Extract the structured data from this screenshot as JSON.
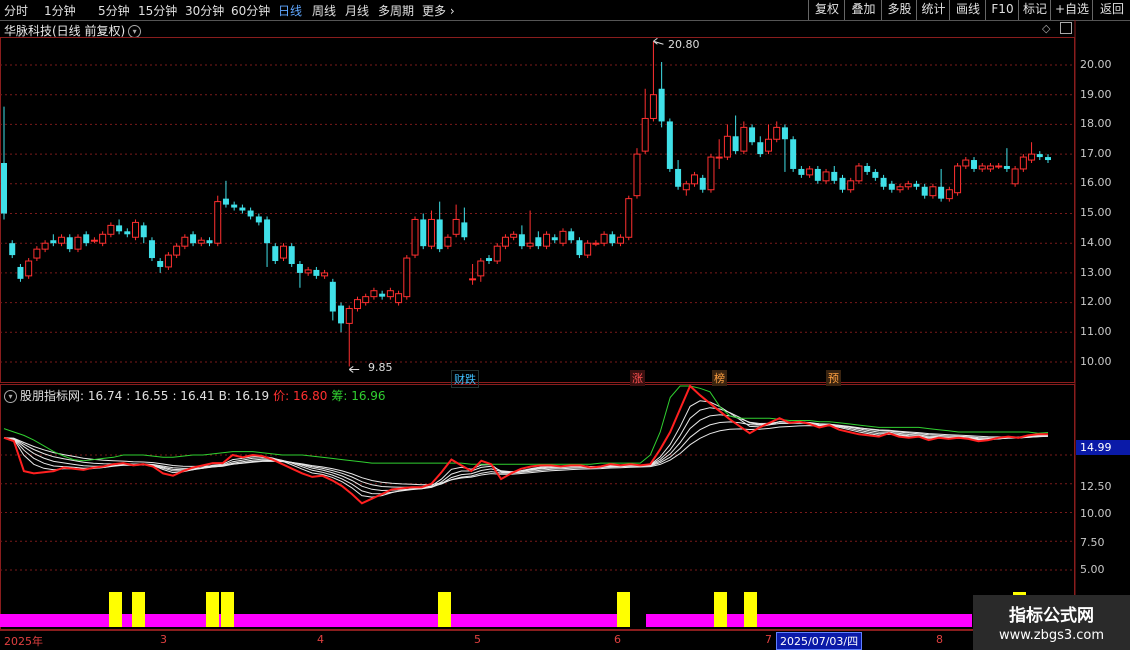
{
  "toolbar": {
    "periods": [
      "分时",
      "1分钟",
      "5分钟",
      "15分钟",
      "30分钟",
      "60分钟",
      "日线",
      "周线",
      "月线",
      "多周期"
    ],
    "active_period": "日线",
    "more_label": "更多",
    "right_buttons": [
      "复权",
      "叠加",
      "多股",
      "统计",
      "画线",
      "F10",
      "+自选",
      "返回"
    ]
  },
  "stock": {
    "title": "华脉科技(日线 前复权)"
  },
  "price_axis": [
    "20.00",
    "19.00",
    "18.00",
    "17.00",
    "16.00",
    "15.00",
    "14.00",
    "13.00",
    "12.00",
    "11.00",
    "10.00"
  ],
  "high_label": "20.80",
  "low_label": "9.85",
  "events": [
    {
      "label": "财跌",
      "color": "#40c0ff"
    },
    {
      "label": "涨",
      "color": "#ff5050"
    },
    {
      "label": "榜",
      "color": "#ffa040"
    },
    {
      "label": "预",
      "color": "#ffa040"
    }
  ],
  "indicator": {
    "name": "股朋指标网",
    "v1": ": 16.74",
    "v2": ": 16.55",
    "v3": ": 16.41",
    "b_label": "B: 16.19",
    "price_label": "价: 16.80",
    "chip_label": "筹: 16.96",
    "axis": [
      "12.50",
      "10.00",
      "7.50",
      "5.00"
    ],
    "axis_partial": "15.00",
    "current_value": "14.99",
    "colors": {
      "price": "#ff3030",
      "chip": "#30d030",
      "b": "#e0e0e0"
    }
  },
  "xaxis": {
    "labels": [
      "2025年",
      "3",
      "4",
      "5",
      "6",
      "7",
      "8"
    ],
    "cursor_date": "2025/07/03/四"
  },
  "watermark": {
    "line1": "指标公式网",
    "line2": "www.zbgs3.com"
  },
  "chart_data": {
    "type": "candlestick",
    "price_range": [
      9.85,
      20.8
    ],
    "candles": [
      [
        16.7,
        15.0,
        18.6,
        14.8
      ],
      [
        14.0,
        13.6,
        14.1,
        13.5
      ],
      [
        13.2,
        12.8,
        13.3,
        12.7
      ],
      [
        12.9,
        13.4,
        13.5,
        12.8
      ],
      [
        13.5,
        13.8,
        13.9,
        13.4
      ],
      [
        13.8,
        14.0,
        14.1,
        13.7
      ],
      [
        14.1,
        14.0,
        14.3,
        13.9
      ],
      [
        14.0,
        14.2,
        14.3,
        13.9
      ],
      [
        14.2,
        13.8,
        14.3,
        13.7
      ],
      [
        13.8,
        14.2,
        14.3,
        13.7
      ],
      [
        14.3,
        14.0,
        14.4,
        13.9
      ],
      [
        14.1,
        14.1,
        14.2,
        14.0
      ],
      [
        14.0,
        14.3,
        14.4,
        13.9
      ],
      [
        14.3,
        14.6,
        14.7,
        14.2
      ],
      [
        14.6,
        14.4,
        14.8,
        14.3
      ],
      [
        14.4,
        14.3,
        14.5,
        14.2
      ],
      [
        14.2,
        14.7,
        14.8,
        14.1
      ],
      [
        14.6,
        14.2,
        14.7,
        14.0
      ],
      [
        14.1,
        13.5,
        14.2,
        13.4
      ],
      [
        13.4,
        13.2,
        13.5,
        13.0
      ],
      [
        13.2,
        13.6,
        13.7,
        13.1
      ],
      [
        13.6,
        13.9,
        14.0,
        13.5
      ],
      [
        13.9,
        14.2,
        14.3,
        13.8
      ],
      [
        14.3,
        14.0,
        14.4,
        13.9
      ],
      [
        14.0,
        14.1,
        14.2,
        13.9
      ],
      [
        14.1,
        14.0,
        14.2,
        13.9
      ],
      [
        14.0,
        15.4,
        15.6,
        13.9
      ],
      [
        15.5,
        15.3,
        16.1,
        15.2
      ],
      [
        15.3,
        15.2,
        15.4,
        15.1
      ],
      [
        15.2,
        15.1,
        15.3,
        15.0
      ],
      [
        15.1,
        14.9,
        15.2,
        14.8
      ],
      [
        14.9,
        14.7,
        15.0,
        14.6
      ],
      [
        14.8,
        14.0,
        14.9,
        13.2
      ],
      [
        13.9,
        13.4,
        14.0,
        13.3
      ],
      [
        13.5,
        13.9,
        14.0,
        13.4
      ],
      [
        13.9,
        13.3,
        14.0,
        13.2
      ],
      [
        13.3,
        13.0,
        13.4,
        12.5
      ],
      [
        13.0,
        13.1,
        13.2,
        12.9
      ],
      [
        13.1,
        12.9,
        13.2,
        12.8
      ],
      [
        12.9,
        13.0,
        13.1,
        12.8
      ],
      [
        12.7,
        11.7,
        12.8,
        11.4
      ],
      [
        11.9,
        11.3,
        12.0,
        11.0
      ],
      [
        11.3,
        11.8,
        11.9,
        9.85
      ],
      [
        11.8,
        12.1,
        12.2,
        11.7
      ],
      [
        12.0,
        12.2,
        12.3,
        11.9
      ],
      [
        12.2,
        12.4,
        12.5,
        12.1
      ],
      [
        12.3,
        12.2,
        12.4,
        12.1
      ],
      [
        12.2,
        12.4,
        12.5,
        12.1
      ],
      [
        12.0,
        12.3,
        12.4,
        11.9
      ],
      [
        12.2,
        13.5,
        13.6,
        12.1
      ],
      [
        13.6,
        14.8,
        14.9,
        13.5
      ],
      [
        14.8,
        13.9,
        15.0,
        13.8
      ],
      [
        13.9,
        14.8,
        15.1,
        13.8
      ],
      [
        14.8,
        13.8,
        15.4,
        13.7
      ],
      [
        13.9,
        14.2,
        14.3,
        13.8
      ],
      [
        14.3,
        14.8,
        15.3,
        14.2
      ],
      [
        14.7,
        14.2,
        15.2,
        14.1
      ],
      [
        12.8,
        12.8,
        13.3,
        12.6
      ],
      [
        12.9,
        13.4,
        13.5,
        12.7
      ],
      [
        13.5,
        13.4,
        13.6,
        13.3
      ],
      [
        13.4,
        13.9,
        14.0,
        13.3
      ],
      [
        13.9,
        14.2,
        14.3,
        13.8
      ],
      [
        14.2,
        14.3,
        14.4,
        14.1
      ],
      [
        14.3,
        13.9,
        14.6,
        13.8
      ],
      [
        13.9,
        14.0,
        15.1,
        13.8
      ],
      [
        14.2,
        13.9,
        14.4,
        13.8
      ],
      [
        13.9,
        14.3,
        14.4,
        13.8
      ],
      [
        14.2,
        14.1,
        14.3,
        14.0
      ],
      [
        14.0,
        14.4,
        14.5,
        13.9
      ],
      [
        14.4,
        14.1,
        14.5,
        14.0
      ],
      [
        14.1,
        13.6,
        14.2,
        13.5
      ],
      [
        13.6,
        14.0,
        14.1,
        13.5
      ],
      [
        14.0,
        14.0,
        14.1,
        13.9
      ],
      [
        14.0,
        14.3,
        14.4,
        13.9
      ],
      [
        14.3,
        14.0,
        14.4,
        13.9
      ],
      [
        14.0,
        14.2,
        14.3,
        13.9
      ],
      [
        14.2,
        15.5,
        15.6,
        14.1
      ],
      [
        15.6,
        17.0,
        17.2,
        15.5
      ],
      [
        17.1,
        18.2,
        19.2,
        17.0
      ],
      [
        18.2,
        19.0,
        20.8,
        18.1
      ],
      [
        19.2,
        18.1,
        20.1,
        17.9
      ],
      [
        18.1,
        16.5,
        18.2,
        16.4
      ],
      [
        16.5,
        15.9,
        16.8,
        15.8
      ],
      [
        15.8,
        16.0,
        16.1,
        15.6
      ],
      [
        16.0,
        16.3,
        16.4,
        15.9
      ],
      [
        16.2,
        15.8,
        16.3,
        15.7
      ],
      [
        15.8,
        16.9,
        17.0,
        15.7
      ],
      [
        16.9,
        16.9,
        17.5,
        16.5
      ],
      [
        16.9,
        17.6,
        18.0,
        16.8
      ],
      [
        17.6,
        17.1,
        18.3,
        17.0
      ],
      [
        17.1,
        17.9,
        18.1,
        17.0
      ],
      [
        17.9,
        17.4,
        18.0,
        17.3
      ],
      [
        17.4,
        17.0,
        17.6,
        16.9
      ],
      [
        17.1,
        17.5,
        18.0,
        17.0
      ],
      [
        17.5,
        17.9,
        18.1,
        17.4
      ],
      [
        17.9,
        17.5,
        18.0,
        16.4
      ],
      [
        17.5,
        16.5,
        17.6,
        16.4
      ],
      [
        16.5,
        16.3,
        16.6,
        16.2
      ],
      [
        16.3,
        16.5,
        16.6,
        16.2
      ],
      [
        16.5,
        16.1,
        16.6,
        16.0
      ],
      [
        16.1,
        16.4,
        16.5,
        16.0
      ],
      [
        16.4,
        16.1,
        16.6,
        16.0
      ],
      [
        16.2,
        15.8,
        16.3,
        15.7
      ],
      [
        15.8,
        16.1,
        16.2,
        15.7
      ],
      [
        16.1,
        16.6,
        16.7,
        16.0
      ],
      [
        16.6,
        16.4,
        16.7,
        16.3
      ],
      [
        16.4,
        16.2,
        16.5,
        16.1
      ],
      [
        16.2,
        15.9,
        16.3,
        15.8
      ],
      [
        16.0,
        15.8,
        16.1,
        15.7
      ],
      [
        15.8,
        15.9,
        16.0,
        15.7
      ],
      [
        15.9,
        16.0,
        16.1,
        15.8
      ],
      [
        16.0,
        15.9,
        16.1,
        15.8
      ],
      [
        15.9,
        15.6,
        16.0,
        15.5
      ],
      [
        15.6,
        15.9,
        16.0,
        15.5
      ],
      [
        15.9,
        15.5,
        16.5,
        15.4
      ],
      [
        15.5,
        15.8,
        15.9,
        15.4
      ],
      [
        15.7,
        16.6,
        16.7,
        15.6
      ],
      [
        16.6,
        16.8,
        16.9,
        16.5
      ],
      [
        16.8,
        16.5,
        16.9,
        16.4
      ],
      [
        16.5,
        16.6,
        16.7,
        16.4
      ],
      [
        16.5,
        16.6,
        16.7,
        16.4
      ],
      [
        16.6,
        16.6,
        16.7,
        16.5
      ],
      [
        16.6,
        16.5,
        17.2,
        16.4
      ],
      [
        16.0,
        16.5,
        16.6,
        15.9
      ],
      [
        16.5,
        16.9,
        17.0,
        16.4
      ],
      [
        16.8,
        17.0,
        17.4,
        16.7
      ],
      [
        17.0,
        16.9,
        17.1,
        16.8
      ],
      [
        16.9,
        16.8,
        17.0,
        16.7
      ]
    ],
    "indicator_series": {
      "price": [
        16.5,
        16.2,
        13.6,
        13.4,
        13.5,
        13.6,
        13.9,
        13.8,
        13.7,
        13.9,
        14.0,
        14.2,
        14.3,
        14.1,
        14.2,
        14.0,
        13.4,
        13.2,
        13.6,
        13.9,
        14.1,
        14.3,
        14.3,
        15.0,
        14.8,
        15.0,
        14.9,
        14.6,
        14.2,
        13.8,
        13.4,
        13.1,
        13.2,
        12.8,
        12.3,
        11.6,
        10.8,
        11.2,
        11.6,
        12.0,
        12.1,
        12.2,
        12.2,
        12.5,
        13.5,
        14.6,
        14.1,
        13.6,
        14.5,
        14.2,
        12.9,
        13.4,
        13.8,
        14.0,
        14.1,
        14.1,
        14.0,
        14.1,
        14.1,
        13.9,
        14.0,
        14.2,
        14.1,
        14.2,
        14.1,
        14.2,
        15.5,
        17.0,
        19.0,
        21.0,
        20.2,
        19.5,
        18.8,
        18.1,
        17.5,
        16.9,
        17.4,
        17.8,
        18.2,
        17.8,
        17.9,
        17.7,
        17.4,
        17.6,
        17.2,
        17.0,
        16.8,
        16.7,
        16.6,
        16.9,
        16.6,
        16.5,
        16.6,
        16.3,
        16.5,
        16.4,
        16.5,
        16.4,
        16.2,
        16.3,
        16.5,
        16.6,
        16.5,
        16.7,
        16.8,
        16.8
      ],
      "chip": [
        17.3,
        17.0,
        16.7,
        16.3,
        15.8,
        15.3,
        14.9,
        14.6,
        14.5,
        14.6,
        14.7,
        14.8,
        15.0,
        15.0,
        15.0,
        14.9,
        14.8,
        14.8,
        14.9,
        15.0,
        15.0,
        15.1,
        15.2,
        15.3,
        15.3,
        15.3,
        15.2,
        15.1,
        15.0,
        15.0,
        15.0,
        14.9,
        14.8,
        14.7,
        14.6,
        14.5,
        14.4,
        14.3,
        14.3,
        14.3,
        14.3,
        14.3,
        14.3,
        14.3,
        14.3,
        14.3,
        14.3,
        14.2,
        14.2,
        14.2,
        14.2,
        14.2,
        14.2,
        14.2,
        14.2,
        14.2,
        14.2,
        14.2,
        14.2,
        14.2,
        14.3,
        14.3,
        14.3,
        14.3,
        14.3,
        15.0,
        17.0,
        20.0,
        21.0,
        21.0,
        20.8,
        20.5,
        19.2,
        18.4,
        18.2,
        18.2,
        18.2,
        18.2,
        18.1,
        18.0,
        18.0,
        18.0,
        17.9,
        17.9,
        17.8,
        17.7,
        17.6,
        17.5,
        17.4,
        17.4,
        17.4,
        17.4,
        17.4,
        17.3,
        17.2,
        17.1,
        17.0,
        17.0,
        17.0,
        17.0,
        17.0,
        17.0,
        17.0,
        17.0,
        16.9,
        16.96
      ]
    },
    "signal_bars": [
      9,
      11,
      17,
      18,
      35,
      50,
      58,
      60,
      84
    ],
    "signal_hidden_range": [
      51,
      52
    ]
  }
}
